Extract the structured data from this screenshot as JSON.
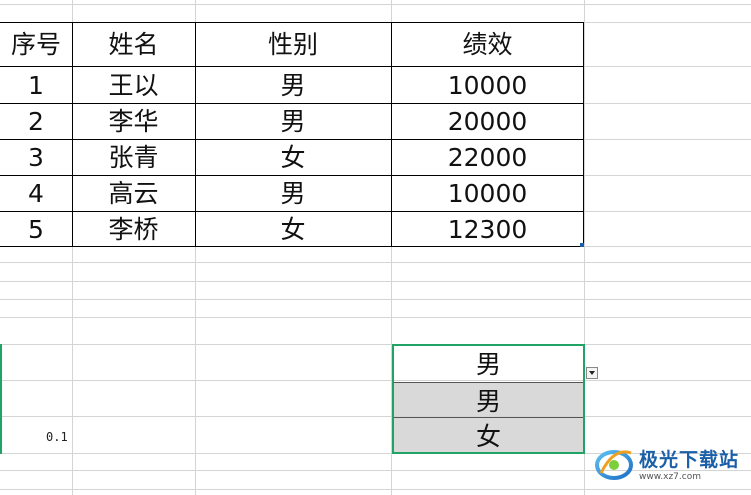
{
  "table": {
    "headers": [
      "序号",
      "姓名",
      "性别",
      "绩效"
    ],
    "rows": [
      [
        "1",
        "王以",
        "男",
        "10000"
      ],
      [
        "2",
        "李华",
        "男",
        "20000"
      ],
      [
        "3",
        "张青",
        "女",
        "22000"
      ],
      [
        "4",
        "高云",
        "男",
        "10000"
      ],
      [
        "5",
        "李桥",
        "女",
        "12300"
      ]
    ]
  },
  "stray_cell": {
    "value": "0.1"
  },
  "dropdown": {
    "selected": "男",
    "options": [
      "男",
      "女"
    ]
  },
  "watermark": {
    "text": "极光下载站",
    "site": "www.xz7.com"
  },
  "colors": {
    "selection": "#21a366",
    "option_bg": "#d9d9d9",
    "gridline": "#d4d4d4"
  },
  "icons": [
    "dropdown-arrow-icon",
    "site-logo-icon"
  ]
}
